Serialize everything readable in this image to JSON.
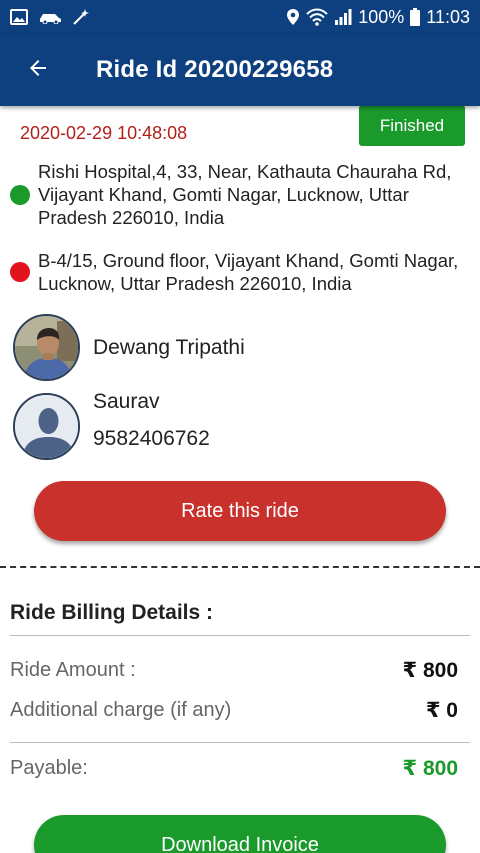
{
  "status_bar": {
    "battery": "100%",
    "time": "11:03",
    "icons": [
      "gallery-icon",
      "car-icon",
      "magic-wand-icon",
      "location-icon",
      "wifi-icon",
      "signal-icon",
      "battery-icon"
    ]
  },
  "app_bar": {
    "back_icon": "arrow-left-icon",
    "title": "Ride Id 20200229658",
    "color": "#0e3f7e"
  },
  "ride": {
    "status": "Finished",
    "datetime": "2020-02-29 10:48:08",
    "pickup_address": "Rishi Hospital,4, 33, Near, Kathauta Chauraha Rd, Vijayant Khand, Gomti Nagar, Lucknow, Uttar Pradesh 226010, India",
    "drop_address": "B-4/15, Ground floor, Vijayant Khand, Gomti Nagar, Lucknow, Uttar Pradesh 226010, India",
    "pickup_color": "#1b9a2c",
    "drop_color": "#e3121f"
  },
  "driver": {
    "name": "Dewang  Tripathi",
    "avatar_icon": "driver-photo"
  },
  "rider": {
    "name": "Saurav",
    "phone": "9582406762",
    "avatar_icon": "default-user-icon"
  },
  "actions": {
    "rate_label": "Rate this ride",
    "download_label": "Download Invoice"
  },
  "billing": {
    "title": "Ride Billing Details :",
    "ride_amount_label": "Ride Amount :",
    "ride_amount_value": "₹ 800",
    "additional_label": "Additional charge (if any)",
    "additional_value": "₹ 0",
    "payable_label": "Payable:",
    "payable_value": "₹ 800"
  },
  "colors": {
    "primary": "#0e3f7e",
    "accent_red": "#c8312c",
    "accent_green": "#1b9a2c",
    "date_red": "#b3201b"
  }
}
